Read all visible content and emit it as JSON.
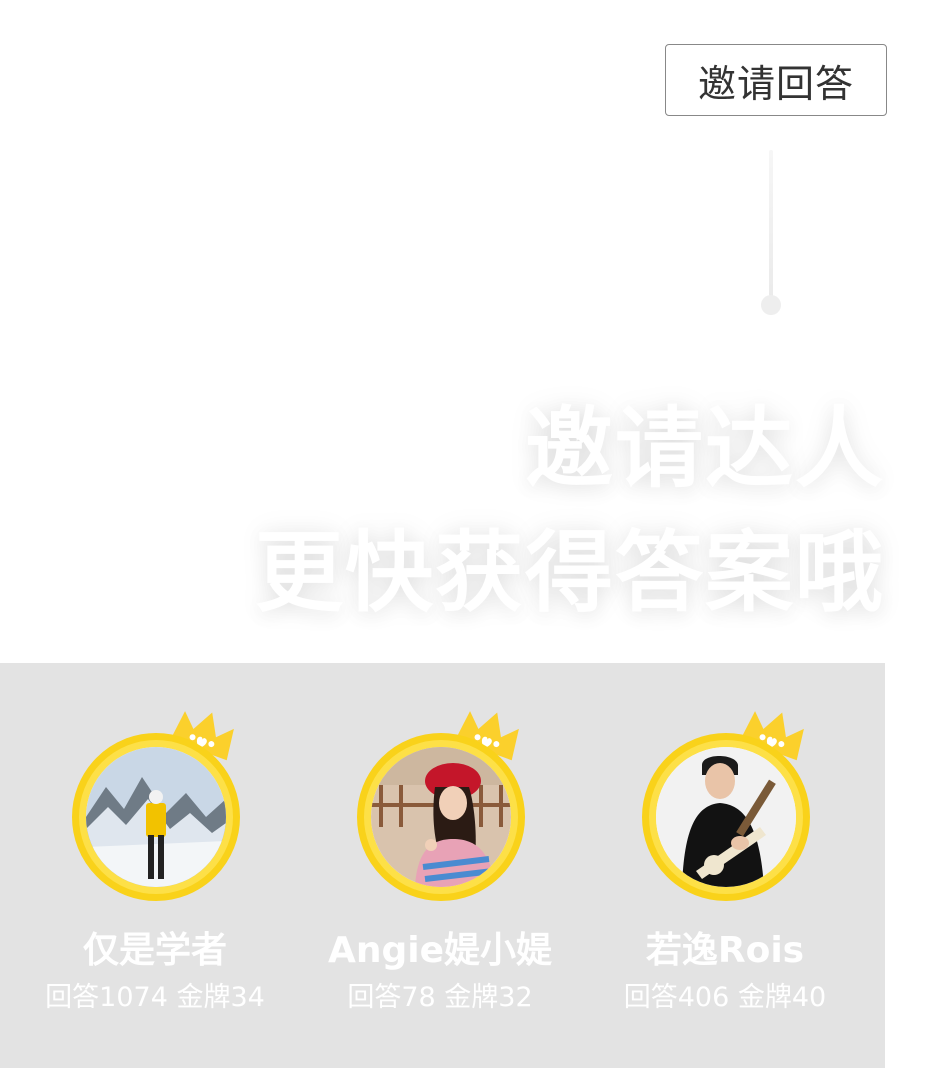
{
  "invite_button": {
    "label": "邀请回答"
  },
  "headline": {
    "line1": "邀请达人",
    "line2": "更快获得答案哦"
  },
  "colors": {
    "panel_bg": "#e3e3e3",
    "ring": "#f9d21a",
    "crown": "#fbd02c"
  },
  "experts": [
    {
      "name": "仅是学者",
      "stats": "回答1074 金牌34"
    },
    {
      "name": "Angie媞小媞",
      "stats": "回答78 金牌32"
    },
    {
      "name": "若逸Rois",
      "stats": "回答406 金牌40"
    }
  ]
}
